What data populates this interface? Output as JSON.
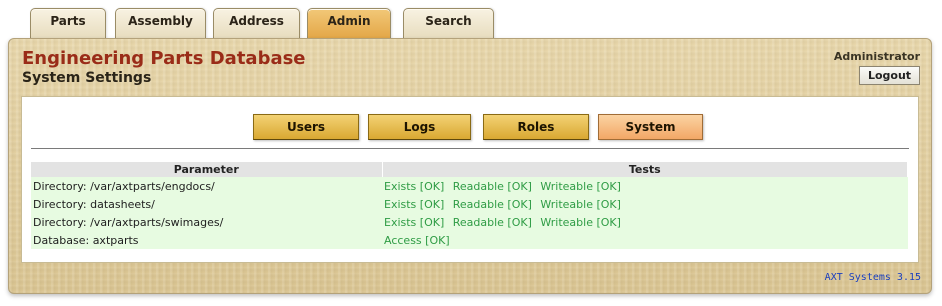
{
  "tabs": [
    {
      "label": "Parts",
      "active": false
    },
    {
      "label": "Assembly",
      "active": false
    },
    {
      "label": "Address",
      "active": false
    },
    {
      "label": "Admin",
      "active": true
    },
    {
      "label": "Search",
      "active": false
    }
  ],
  "header": {
    "app_title": "Engineering Parts Database",
    "page_subtitle": "System Settings",
    "user": "Administrator",
    "logout_label": "Logout"
  },
  "admin_buttons": [
    {
      "label": "Users",
      "active": false
    },
    {
      "label": "Logs",
      "active": false
    },
    {
      "label": "Roles",
      "active": false
    },
    {
      "label": "System",
      "active": true
    }
  ],
  "table": {
    "columns": [
      "Parameter",
      "Tests"
    ],
    "rows": [
      {
        "parameter": "Directory: /var/axtparts/engdocs/",
        "tests": [
          "Exists [OK]",
          "Readable [OK]",
          "Writeable [OK]"
        ]
      },
      {
        "parameter": "Directory: datasheets/",
        "tests": [
          "Exists [OK]",
          "Readable [OK]",
          "Writeable [OK]"
        ]
      },
      {
        "parameter": "Directory: /var/axtparts/swimages/",
        "tests": [
          "Exists [OK]",
          "Readable [OK]",
          "Writeable [OK]"
        ]
      },
      {
        "parameter": "Database: axtparts",
        "tests": [
          "Access [OK]"
        ]
      }
    ]
  },
  "footer": {
    "version": "AXT Systems 3.15"
  },
  "colors": {
    "title": "#9a2c18",
    "active_tab": "#e3a646",
    "ok_text": "#2f9c45",
    "row_background": "#e7fbe1",
    "version_text": "#1a3fbf"
  }
}
